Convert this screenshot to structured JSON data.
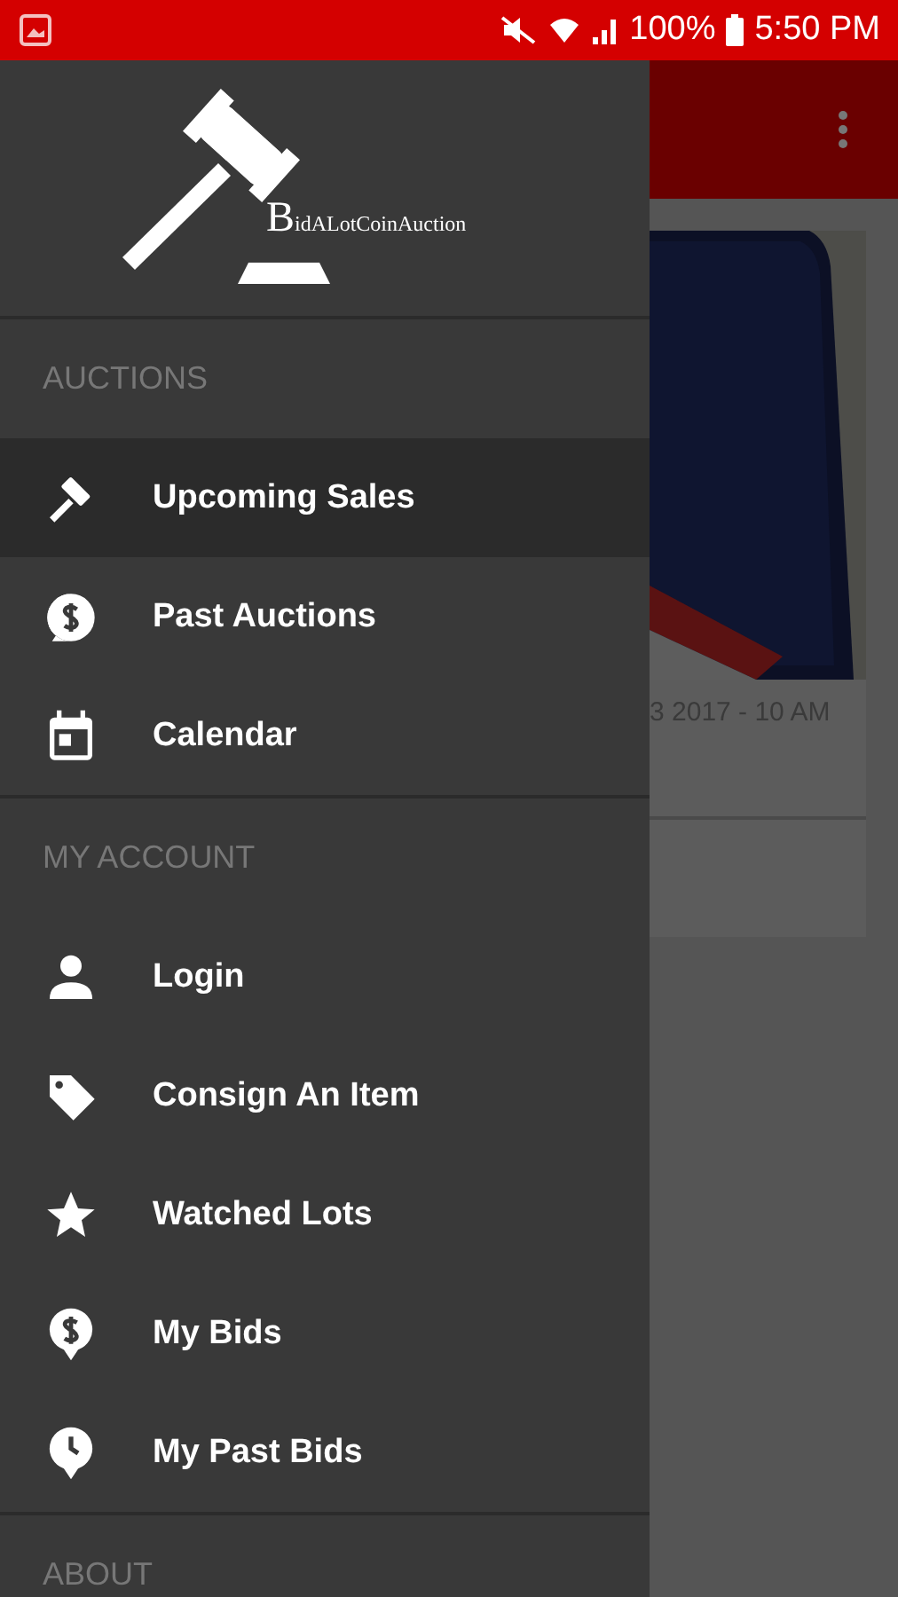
{
  "status_bar": {
    "battery": "100%",
    "time": "5:50 PM"
  },
  "drawer": {
    "logo_text": "BidALotCoinAuction",
    "sections": [
      {
        "title": "AUCTIONS",
        "items": [
          {
            "label": "Upcoming Sales",
            "kind": "gavel",
            "selected": true
          },
          {
            "label": "Past Auctions",
            "kind": "dollar-bubble",
            "selected": false
          },
          {
            "label": "Calendar",
            "kind": "calendar",
            "selected": false
          }
        ]
      },
      {
        "title": "MY ACCOUNT",
        "items": [
          {
            "label": "Login",
            "kind": "person",
            "selected": false
          },
          {
            "label": "Consign An Item",
            "kind": "tag",
            "selected": false
          },
          {
            "label": "Watched Lots",
            "kind": "star",
            "selected": false
          },
          {
            "label": "My Bids",
            "kind": "dollar-pin",
            "selected": false
          },
          {
            "label": "My Past Bids",
            "kind": "clock-pin",
            "selected": false
          }
        ]
      },
      {
        "title": "ABOUT"
      }
    ]
  },
  "background": {
    "card_date": "3 2017 - 10 AM"
  }
}
